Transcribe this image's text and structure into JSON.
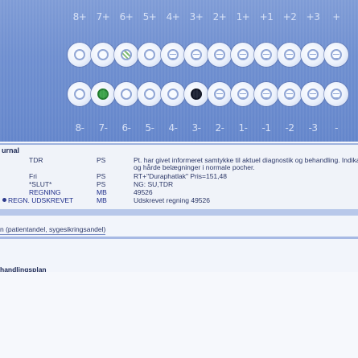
{
  "odontogram": {
    "upper_labels": [
      "8+",
      "7+",
      "6+",
      "5+",
      "4+",
      "3+",
      "2+",
      "1+",
      "+1",
      "+2",
      "+3",
      "+"
    ],
    "lower_labels": [
      "8-",
      "7-",
      "6-",
      "5-",
      "4-",
      "3-",
      "2-",
      "1-",
      "-1",
      "-2",
      "-3",
      "-"
    ]
  },
  "journal": {
    "title": "urnal",
    "rows": [
      {
        "code": "TDR",
        "user": "PS",
        "text": "Pt. har givet informeret samtykke til aktuel diagnostik og behandling. Indika"
      },
      {
        "code": "",
        "user": "",
        "text": "og hårde belægninger i normale pocher."
      },
      {
        "code": "Fri",
        "user": "PS",
        "text": "RT+\"Duraphatlak\" Pris=151,48"
      },
      {
        "code": "*SLUT*",
        "user": "PS",
        "text": "NG: SU,TDR"
      },
      {
        "code": "REGNING",
        "user": "MB",
        "text": "49526"
      },
      {
        "code": "REGN. UDSKREVET",
        "user": "MB",
        "text": "Udskrevet regning 49526"
      }
    ]
  },
  "payment": {
    "label": "n (patientandel, sygesikringsandel)"
  },
  "plan": {
    "title": "handlingsplan"
  }
}
